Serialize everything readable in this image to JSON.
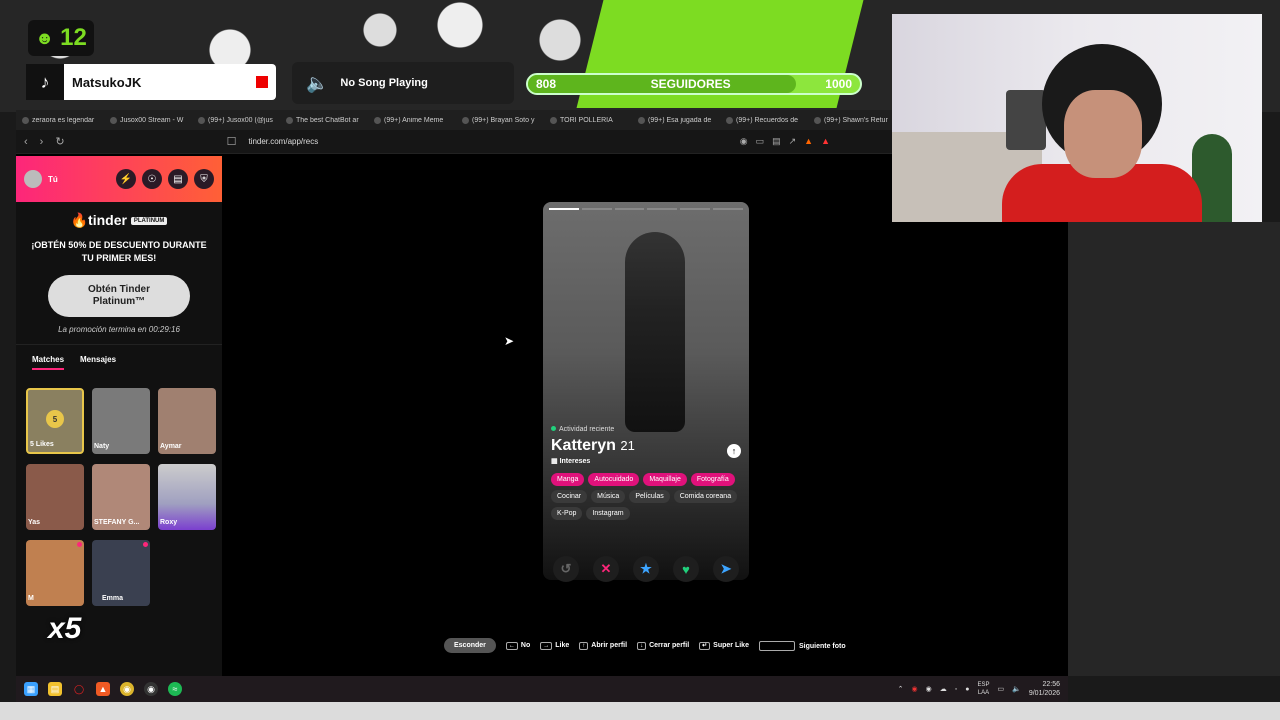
{
  "overlay": {
    "viewer_count": "12",
    "username": "MatsukoJK",
    "song": "No Song Playing",
    "followers": {
      "current": "808",
      "label": "SEGUIDORES",
      "goal": "1000",
      "progress_fraction": 0.808
    },
    "x5": "x5"
  },
  "browser": {
    "tabs": [
      "zeraora es legendar",
      "Jusox00 Stream - W",
      "(99+) Jusox00 (@jus",
      "The best ChatBot ar",
      "(99+) Anime Meme",
      "(99+) Brayan Soto y",
      "TORI POLLERIA",
      "(99+) Esa jugada de",
      "(99+) Recuerdos de",
      "(99+) Shawn's Retur"
    ],
    "url": "tinder.com/app/recs"
  },
  "sidebar": {
    "you_label": "Tú",
    "logo": "tinder",
    "logo_badge": "PLATINUM",
    "offer": "¡OBTÉN 50% DE DESCUENTO DURANTE TU PRIMER MES!",
    "cta": "Obtén Tinder Platinum™",
    "timer": "La promoción termina en 00:29:16",
    "tabs": [
      "Matches",
      "Mensajes"
    ],
    "likes": {
      "count": "5",
      "label": "5 Likes"
    },
    "matches": [
      "Naty",
      "Aymar",
      "Yas",
      "STEFANY G...",
      "Roxy",
      "M",
      "Emma"
    ]
  },
  "card": {
    "activity": "Actividad reciente",
    "name": "Katteryn",
    "age": "21",
    "interests_label": "Intereses",
    "tags": [
      {
        "label": "Manga",
        "highlight": true
      },
      {
        "label": "Autocuidado",
        "highlight": true
      },
      {
        "label": "Maquillaje",
        "highlight": true
      },
      {
        "label": "Fotografía",
        "highlight": true
      },
      {
        "label": "Cocinar",
        "highlight": false
      },
      {
        "label": "Música",
        "highlight": false
      },
      {
        "label": "Películas",
        "highlight": false
      },
      {
        "label": "Comida coreana",
        "highlight": false
      },
      {
        "label": "K-Pop",
        "highlight": false
      },
      {
        "label": "Instagram",
        "highlight": false
      }
    ]
  },
  "actions": [
    "rewind-icon",
    "nope-icon",
    "superlike-icon",
    "like-icon",
    "boost-icon"
  ],
  "shortcuts": {
    "hide": "Esconder",
    "no": "No",
    "like": "Like",
    "open": "Abrir perfil",
    "close": "Cerrar perfil",
    "superlike": "Super Like",
    "next": "Siguiente foto"
  },
  "taskbar": {
    "lang_top": "ESP",
    "lang_bottom": "LAA",
    "time": "22:56",
    "date": "9/01/2026"
  },
  "colors": {
    "tinder_pink": "#fd267a",
    "tinder_orange": "#ff6036",
    "stream_green": "#7ddc22"
  }
}
